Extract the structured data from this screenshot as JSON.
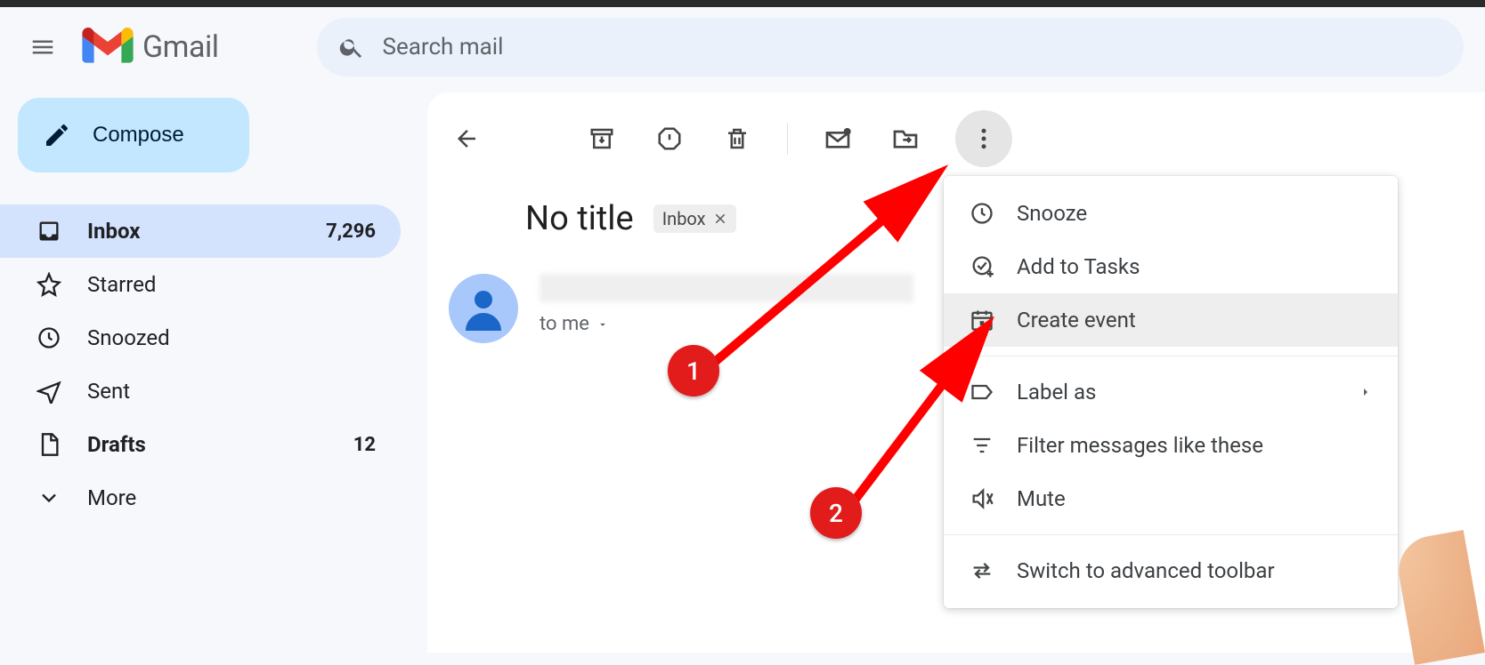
{
  "app": {
    "name": "Gmail"
  },
  "search": {
    "placeholder": "Search mail"
  },
  "compose": {
    "label": "Compose"
  },
  "sidebar": {
    "items": [
      {
        "label": "Inbox",
        "count": "7,296"
      },
      {
        "label": "Starred"
      },
      {
        "label": "Snoozed"
      },
      {
        "label": "Sent"
      },
      {
        "label": "Drafts",
        "count": "12"
      },
      {
        "label": "More"
      }
    ]
  },
  "email": {
    "subject": "No title",
    "label_chip": "Inbox",
    "recipient_prefix": "to me"
  },
  "menu": {
    "snooze": "Snooze",
    "add_to_tasks": "Add to Tasks",
    "create_event": "Create event",
    "label_as": "Label as",
    "filter": "Filter messages like these",
    "mute": "Mute",
    "switch_toolbar": "Switch to advanced toolbar"
  },
  "annotations": {
    "badge1": "1",
    "badge2": "2"
  }
}
